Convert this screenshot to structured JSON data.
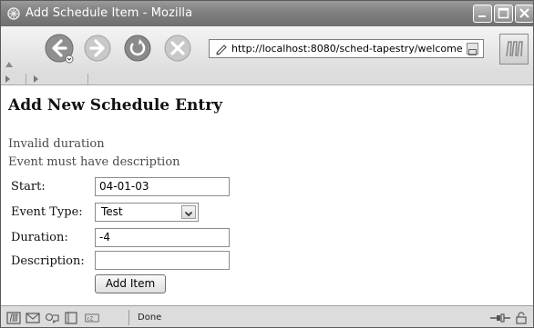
{
  "window": {
    "title": "Add Schedule Item - Mozilla"
  },
  "toolbar": {
    "url": "http://localhost:8080/sched-tapestry/welcome"
  },
  "page": {
    "title": "Add New Schedule Entry",
    "errors": [
      "Invalid duration",
      "Event must have description"
    ]
  },
  "form": {
    "start_label": "Start:",
    "start_value": "04-01-03",
    "event_type_label": "Event Type:",
    "event_type_value": "Test",
    "duration_label": "Duration:",
    "duration_value": "-4",
    "description_label": "Description:",
    "description_value": "",
    "submit_label": "Add Item"
  },
  "status": {
    "text": "Done"
  },
  "icons": {
    "app": "mozilla-app-icon",
    "back": "back-icon",
    "forward": "forward-icon",
    "reload": "reload-icon",
    "stop": "stop-icon",
    "throbber": "mozilla-logo-icon"
  }
}
